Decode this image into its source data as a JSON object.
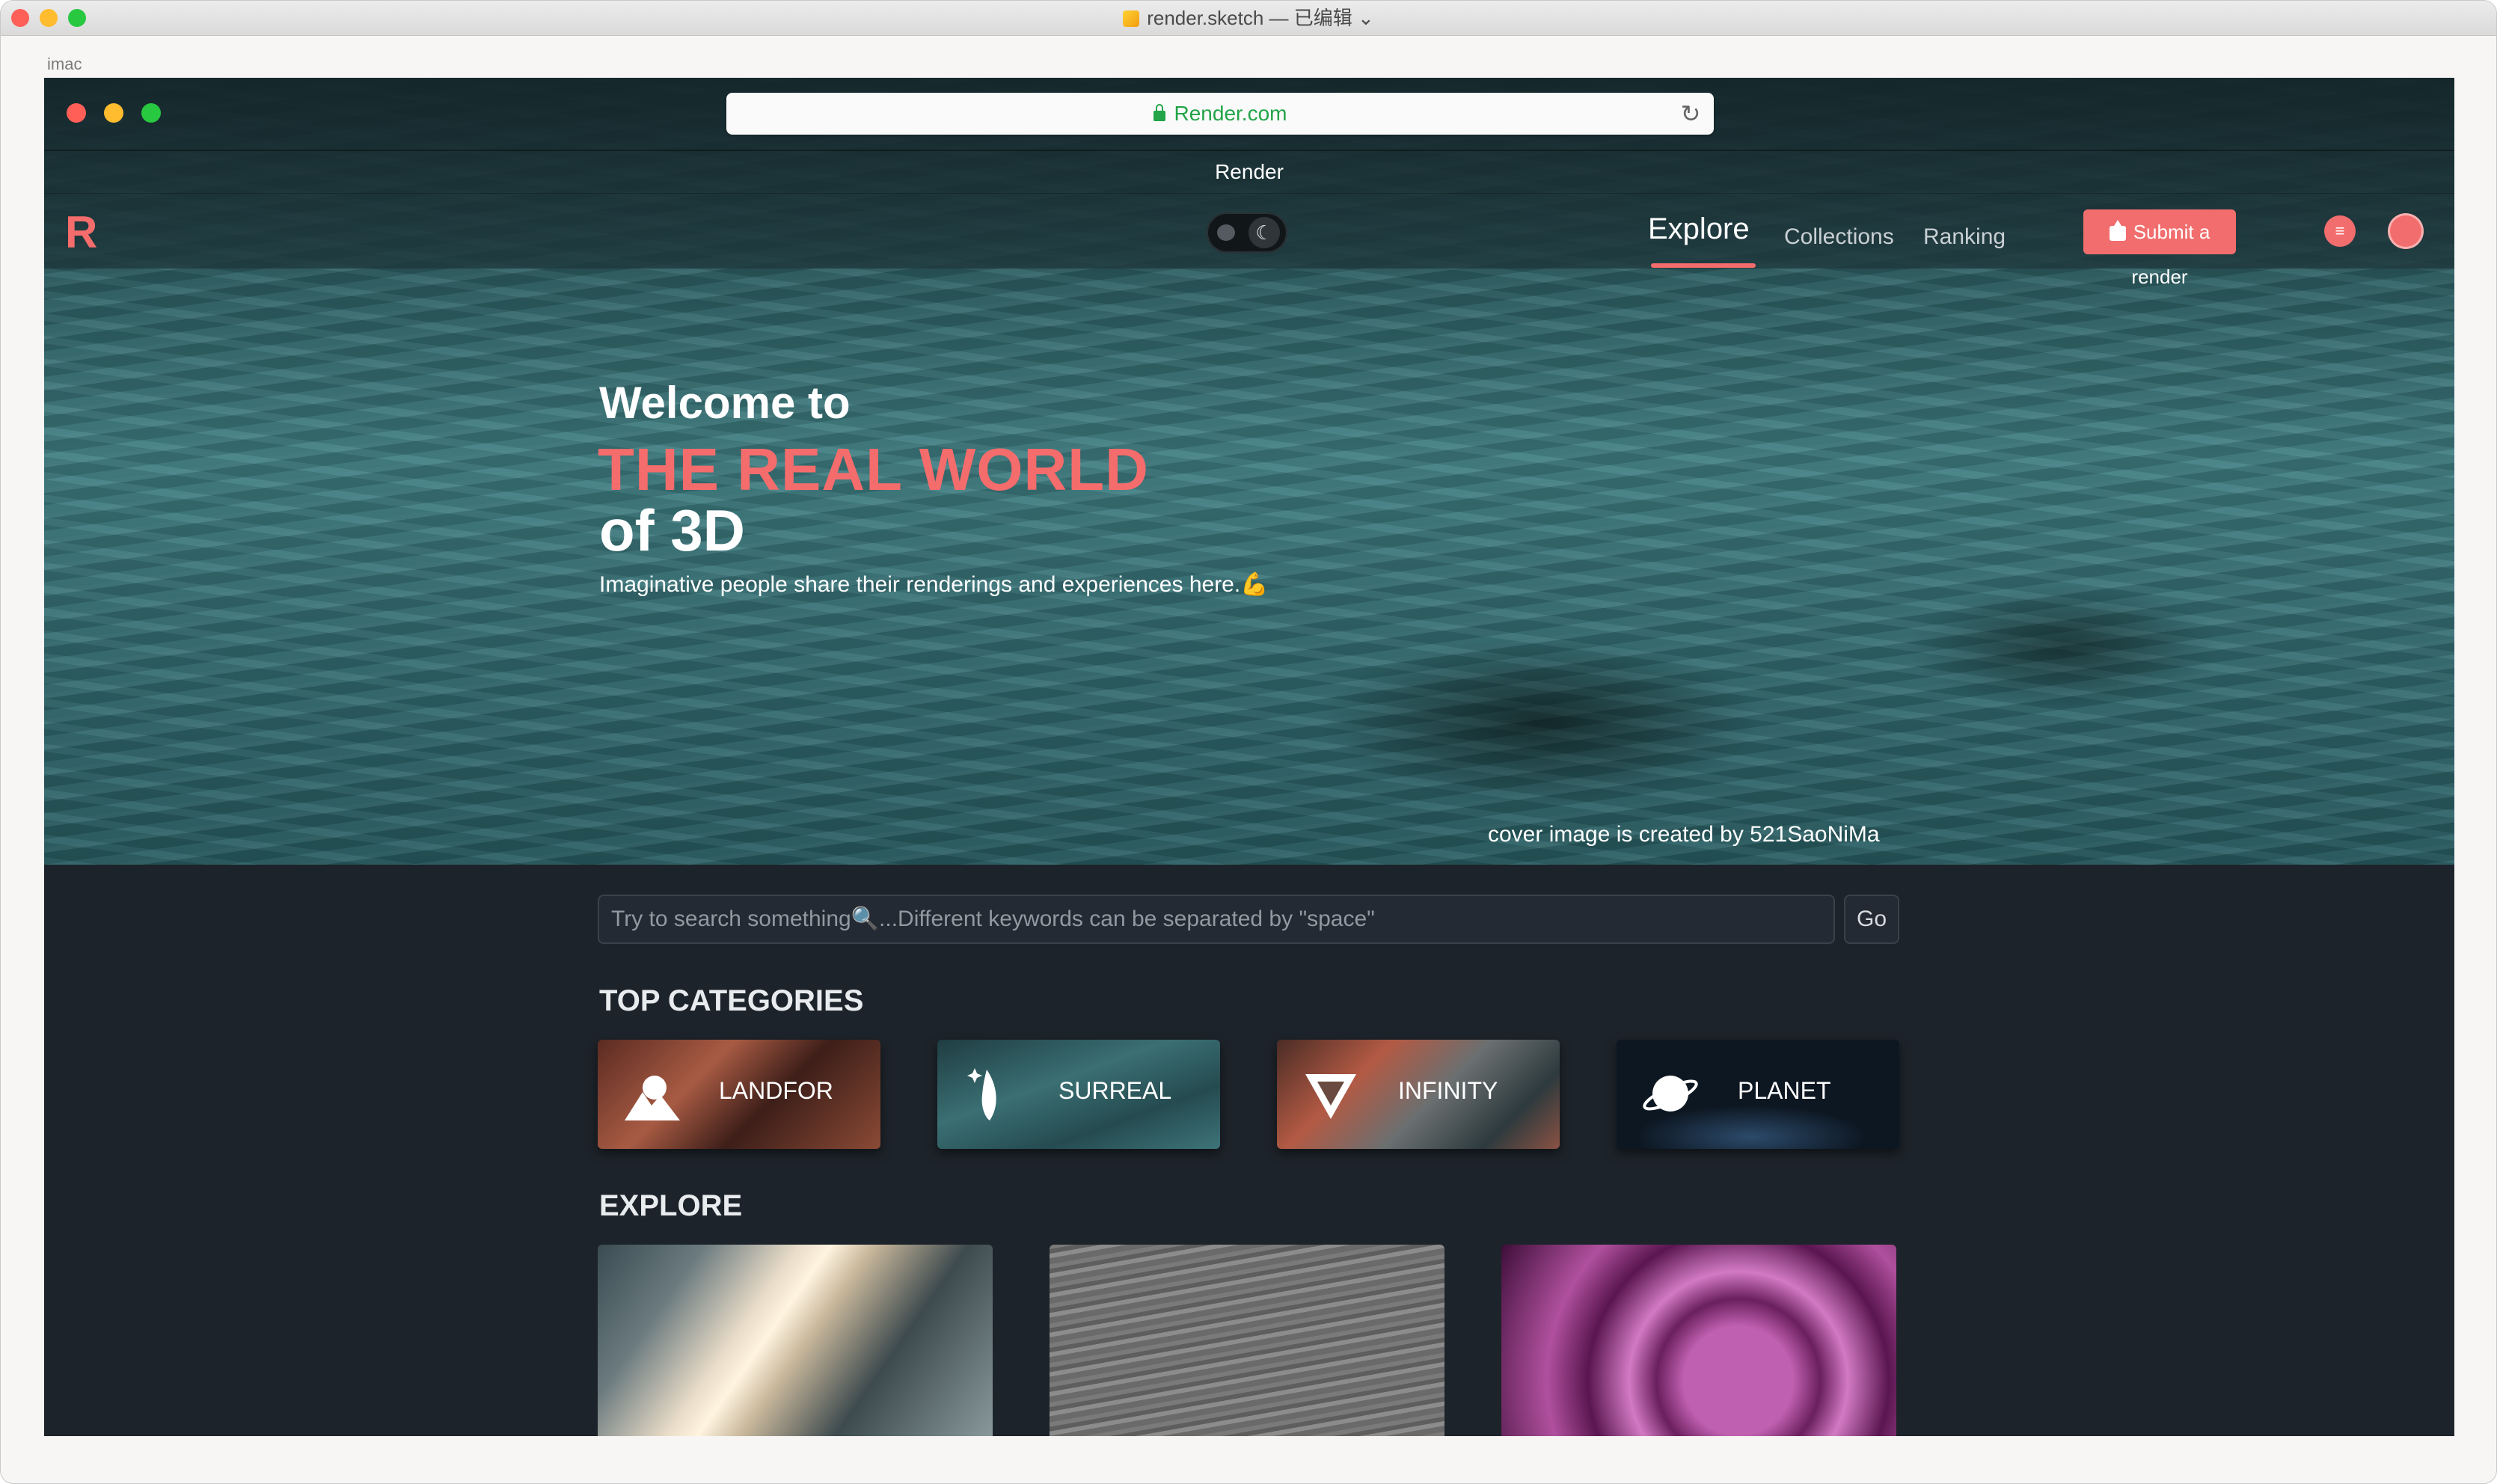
{
  "window": {
    "title": "render.sketch — 已编辑",
    "artboard_label": "imac"
  },
  "browser": {
    "url": "Render.com",
    "tab_title": "Render"
  },
  "navbar": {
    "logo": "R",
    "links": {
      "explore": "Explore",
      "collections": "Collections",
      "ranking": "Ranking"
    },
    "submit_label": "Submit a render",
    "theme_mode": "dark"
  },
  "hero": {
    "welcome": "Welcome to",
    "headline": "THE REAL WORLD",
    "headline2": "of 3D",
    "tagline": "Imaginative people share their renderings and experiences here.💪",
    "credit": "cover image is created by 521SaoNiMa"
  },
  "search": {
    "placeholder": "Try to search something🔍...Different keywords can be separated by \"space\"",
    "go_label": "Go"
  },
  "top_categories": {
    "title": "TOP CATEGORIES",
    "items": [
      "LANDFOR",
      "SURREAL",
      "INFINITY",
      "PLANET"
    ]
  },
  "explore": {
    "title": "EXPLORE"
  },
  "colors": {
    "accent": "#f56c6c",
    "background": "#1d232a",
    "url_green": "#22a447"
  }
}
